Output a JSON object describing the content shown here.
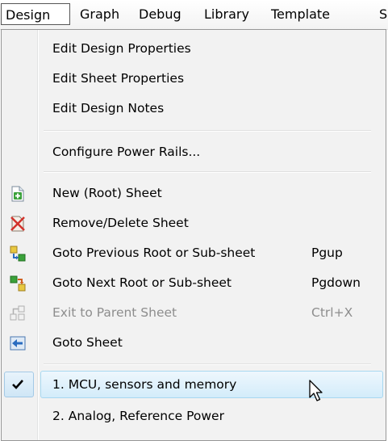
{
  "menubar": {
    "items": [
      "Design",
      "Graph",
      "Debug",
      "Library",
      "Template",
      "S"
    ]
  },
  "menu": {
    "items": [
      {
        "label": "Edit Design Properties",
        "icon": "",
        "shortcut": ""
      },
      {
        "label": "Edit Sheet Properties",
        "icon": "",
        "shortcut": ""
      },
      {
        "label": "Edit Design Notes",
        "icon": "",
        "shortcut": ""
      },
      {
        "label": "Configure Power Rails...",
        "icon": "",
        "shortcut": ""
      },
      {
        "label": "New (Root) Sheet",
        "icon": "new-sheet-icon",
        "shortcut": ""
      },
      {
        "label": "Remove/Delete Sheet",
        "icon": "delete-sheet-icon",
        "shortcut": ""
      },
      {
        "label": "Goto Previous Root or Sub-sheet",
        "icon": "previous-sheet-icon",
        "shortcut": "Pgup"
      },
      {
        "label": "Goto Next Root or Sub-sheet",
        "icon": "next-sheet-icon",
        "shortcut": "Pgdown"
      },
      {
        "label": "Exit to Parent Sheet",
        "icon": "parent-sheet-icon",
        "shortcut": "Ctrl+X",
        "disabled": true
      },
      {
        "label": "Goto Sheet",
        "icon": "goto-sheet-icon",
        "shortcut": ""
      },
      {
        "label": "1. MCU, sensors and memory",
        "icon": "checkmark-icon",
        "shortcut": "",
        "checked": true,
        "hovered": true
      },
      {
        "label": "2. Analog, Reference Power",
        "icon": "",
        "shortcut": ""
      }
    ]
  },
  "colors": {
    "hover_border": "#a8d8f0",
    "menu_bg": "#f2f2f2",
    "disabled_text": "#8d8d8d"
  }
}
